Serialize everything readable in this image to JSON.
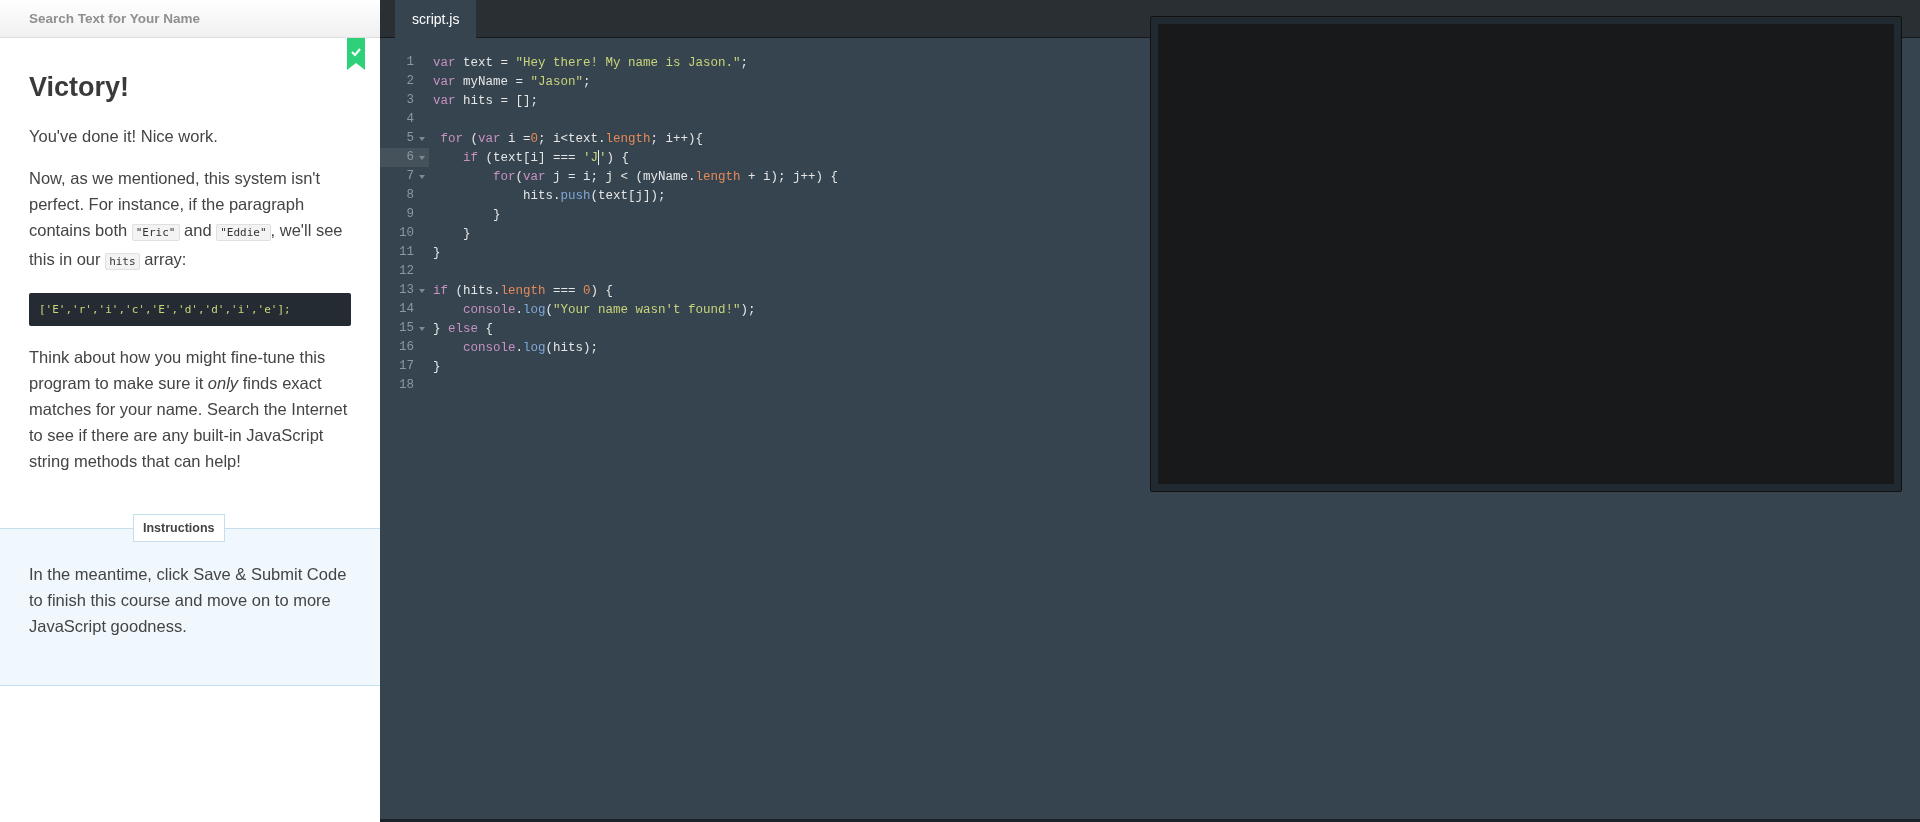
{
  "lesson": {
    "header": "Search Text for Your Name",
    "completed": true,
    "title": "Victory!",
    "paragraphs": [
      {
        "kind": "text",
        "parts": [
          {
            "kind": "text",
            "text": "You've done it! Nice work."
          }
        ]
      },
      {
        "kind": "text",
        "parts": [
          {
            "kind": "text",
            "text": "Now, as we mentioned, this system isn't perfect. For instance, if the paragraph contains both "
          },
          {
            "kind": "code",
            "text": "\"Eric\""
          },
          {
            "kind": "text",
            "text": " and "
          },
          {
            "kind": "code",
            "text": "\"Eddie\""
          },
          {
            "kind": "text",
            "text": ", we'll see this in our "
          },
          {
            "kind": "code",
            "text": "hits"
          },
          {
            "kind": "text",
            "text": " array:"
          }
        ]
      },
      {
        "kind": "codeblock",
        "parts": [
          {
            "kind": "code",
            "text": "['E','r','i','c','E','d','d','i','e'];"
          }
        ]
      },
      {
        "kind": "text",
        "parts": [
          {
            "kind": "text",
            "text": "Think about how you might fine-tune this program to make sure it *only* finds exact matches for your name. Search the Internet to see if there are any built-in JavaScript string methods that can help!"
          }
        ]
      }
    ],
    "instructions": {
      "label": "Instructions",
      "text": "In the meantime, click Save & Submit Code to finish this course and move on to more JavaScript goodness."
    }
  },
  "editor": {
    "tabs": [
      {
        "label": "script.js",
        "selected": true
      }
    ],
    "lines": [
      {
        "number": "1",
        "foldable": false,
        "active": false,
        "tokens": [
          {
            "kind": "kw",
            "text": "var"
          },
          {
            "kind": "plain",
            "text": " text = "
          },
          {
            "kind": "str",
            "text": "\"Hey there! My name is Jason.\""
          },
          {
            "kind": "plain",
            "text": ";"
          }
        ]
      },
      {
        "number": "2",
        "foldable": false,
        "active": false,
        "tokens": [
          {
            "kind": "kw",
            "text": "var"
          },
          {
            "kind": "plain",
            "text": " myName = "
          },
          {
            "kind": "str",
            "text": "\"Jason\""
          },
          {
            "kind": "plain",
            "text": ";"
          }
        ]
      },
      {
        "number": "3",
        "foldable": false,
        "active": false,
        "tokens": [
          {
            "kind": "kw",
            "text": "var"
          },
          {
            "kind": "plain",
            "text": " hits = [];"
          }
        ]
      },
      {
        "number": "4",
        "foldable": false,
        "active": false
      },
      {
        "number": "5",
        "foldable": true,
        "active": false,
        "tokens": [
          {
            "kind": "kw",
            "text": " for"
          },
          {
            "kind": "plain",
            "text": " ("
          },
          {
            "kind": "kw",
            "text": "var"
          },
          {
            "kind": "plain",
            "text": " i ="
          },
          {
            "kind": "num",
            "text": "0"
          },
          {
            "kind": "plain",
            "text": "; i<text."
          },
          {
            "kind": "num",
            "text": "length"
          },
          {
            "kind": "plain",
            "text": "; i++){"
          }
        ]
      },
      {
        "number": "6",
        "foldable": true,
        "active": true,
        "tokens": [
          {
            "kind": "kw",
            "text": "    if"
          },
          {
            "kind": "plain",
            "text": " (text[i] === "
          },
          {
            "kind": "str",
            "text": "'J"
          },
          {
            "kind": "cursor"
          },
          {
            "kind": "str",
            "text": "'"
          },
          {
            "kind": "plain",
            "text": ") {"
          }
        ]
      },
      {
        "number": "7",
        "foldable": true,
        "active": false,
        "tokens": [
          {
            "kind": "kw",
            "text": "        for"
          },
          {
            "kind": "plain",
            "text": "("
          },
          {
            "kind": "kw",
            "text": "var"
          },
          {
            "kind": "plain",
            "text": " j = i; j < (myName."
          },
          {
            "kind": "num",
            "text": "length"
          },
          {
            "kind": "plain",
            "text": " + i); j++) {"
          }
        ]
      },
      {
        "number": "8",
        "foldable": false,
        "active": false,
        "tokens": [
          {
            "kind": "plain",
            "text": "            hits."
          },
          {
            "kind": "fn",
            "text": "push"
          },
          {
            "kind": "plain",
            "text": "(text[j]);"
          }
        ]
      },
      {
        "number": "9",
        "foldable": false,
        "active": false,
        "tokens": [
          {
            "kind": "plain",
            "text": "        }"
          }
        ]
      },
      {
        "number": "10",
        "foldable": false,
        "active": false,
        "tokens": [
          {
            "kind": "plain",
            "text": "    }"
          }
        ]
      },
      {
        "number": "11",
        "foldable": false,
        "active": false,
        "tokens": [
          {
            "kind": "plain",
            "text": "}"
          }
        ]
      },
      {
        "number": "12",
        "foldable": false,
        "active": false
      },
      {
        "number": "13",
        "foldable": true,
        "active": false,
        "tokens": [
          {
            "kind": "kw",
            "text": "if"
          },
          {
            "kind": "plain",
            "text": " (hits."
          },
          {
            "kind": "num",
            "text": "length"
          },
          {
            "kind": "plain",
            "text": " === "
          },
          {
            "kind": "num",
            "text": "0"
          },
          {
            "kind": "plain",
            "text": ") {"
          }
        ]
      },
      {
        "number": "14",
        "foldable": false,
        "active": false,
        "tokens": [
          {
            "kind": "kw",
            "text": "    console"
          },
          {
            "kind": "plain",
            "text": "."
          },
          {
            "kind": "fn",
            "text": "log"
          },
          {
            "kind": "plain",
            "text": "("
          },
          {
            "kind": "str",
            "text": "\"Your name wasn't found!\""
          },
          {
            "kind": "plain",
            "text": ");"
          }
        ]
      },
      {
        "number": "15",
        "foldable": true,
        "active": false,
        "tokens": [
          {
            "kind": "plain",
            "text": "} "
          },
          {
            "kind": "kw",
            "text": "else"
          },
          {
            "kind": "plain",
            "text": " {"
          }
        ]
      },
      {
        "number": "16",
        "foldable": false,
        "active": false,
        "tokens": [
          {
            "kind": "kw",
            "text": "    console"
          },
          {
            "kind": "plain",
            "text": "."
          },
          {
            "kind": "fn",
            "text": "log"
          },
          {
            "kind": "plain",
            "text": "(hits);"
          }
        ]
      },
      {
        "number": "17",
        "foldable": false,
        "active": false,
        "tokens": [
          {
            "kind": "plain",
            "text": "}"
          }
        ]
      },
      {
        "number": "18",
        "foldable": false,
        "active": false
      }
    ]
  }
}
